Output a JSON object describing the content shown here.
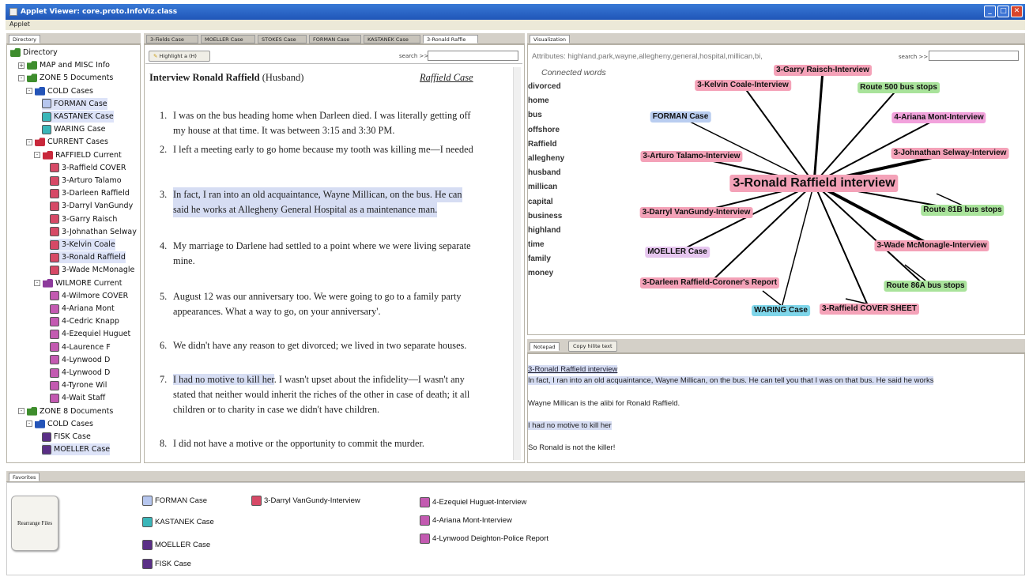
{
  "window": {
    "title": "Applet Viewer: core.proto.InfoViz.class",
    "menu": "Applet"
  },
  "directory": {
    "tab": "Directory",
    "rows": [
      {
        "label": "Directory",
        "icon": "folder-green",
        "indent": 0,
        "exp": ""
      },
      {
        "label": "MAP and MISC Info",
        "icon": "folder-green",
        "indent": 1,
        "exp": "+"
      },
      {
        "label": "ZONE 5 Documents",
        "icon": "folder-green",
        "indent": 1,
        "exp": "-"
      },
      {
        "label": "COLD Cases",
        "icon": "folder-blue",
        "indent": 2,
        "exp": "-"
      },
      {
        "label": "FORMAN Case",
        "icon": "doc-blue",
        "indent": 4,
        "exp": "",
        "selected": true
      },
      {
        "label": "KASTANEK Case",
        "icon": "doc-teal",
        "indent": 4,
        "exp": "",
        "selected": true
      },
      {
        "label": "WARING Case",
        "icon": "doc-teal",
        "indent": 4,
        "exp": ""
      },
      {
        "label": "CURRENT Cases",
        "icon": "folder-red",
        "indent": 2,
        "exp": "-"
      },
      {
        "label": "RAFFIELD Current",
        "icon": "folder-red",
        "indent": 3,
        "exp": "-"
      },
      {
        "label": "3-Raffield COVER",
        "icon": "doc-red",
        "indent": 5,
        "exp": ""
      },
      {
        "label": "3-Arturo Talamo",
        "icon": "doc-red",
        "indent": 5,
        "exp": ""
      },
      {
        "label": "3-Darleen Raffield",
        "icon": "doc-red",
        "indent": 5,
        "exp": ""
      },
      {
        "label": "3-Darryl VanGundy",
        "icon": "doc-red",
        "indent": 5,
        "exp": ""
      },
      {
        "label": "3-Garry Raisch",
        "icon": "doc-red",
        "indent": 5,
        "exp": ""
      },
      {
        "label": "3-Johnathan Selway",
        "icon": "doc-red",
        "indent": 5,
        "exp": ""
      },
      {
        "label": "3-Kelvin Coale",
        "icon": "doc-red",
        "indent": 5,
        "exp": "",
        "selected": true
      },
      {
        "label": "3-Ronald Raffield",
        "icon": "doc-red",
        "indent": 5,
        "exp": "",
        "selected": true
      },
      {
        "label": "3-Wade McMonagle",
        "icon": "doc-red",
        "indent": 5,
        "exp": ""
      },
      {
        "label": "WILMORE Current",
        "icon": "folder-purple",
        "indent": 3,
        "exp": "-"
      },
      {
        "label": "4-Wilmore COVER",
        "icon": "doc-purple",
        "indent": 5,
        "exp": ""
      },
      {
        "label": "4-Ariana Mont",
        "icon": "doc-purple",
        "indent": 5,
        "exp": ""
      },
      {
        "label": "4-Cedric Knapp",
        "icon": "doc-purple",
        "indent": 5,
        "exp": ""
      },
      {
        "label": "4-Ezequiel Huguet",
        "icon": "doc-purple",
        "indent": 5,
        "exp": ""
      },
      {
        "label": "4-Laurence F",
        "icon": "doc-purple",
        "indent": 5,
        "exp": ""
      },
      {
        "label": "4-Lynwood D",
        "icon": "doc-purple",
        "indent": 5,
        "exp": ""
      },
      {
        "label": "4-Lynwood D",
        "icon": "doc-purple",
        "indent": 5,
        "exp": ""
      },
      {
        "label": "4-Tyrone Wil",
        "icon": "doc-purple",
        "indent": 5,
        "exp": ""
      },
      {
        "label": "4-Wait Staff",
        "icon": "doc-purple",
        "indent": 5,
        "exp": ""
      },
      {
        "label": "ZONE 8 Documents",
        "icon": "folder-green",
        "indent": 1,
        "exp": "-"
      },
      {
        "label": "COLD Cases",
        "icon": "folder-blue",
        "indent": 2,
        "exp": "-"
      },
      {
        "label": "FISK Case",
        "icon": "doc-dpurple",
        "indent": 4,
        "exp": ""
      },
      {
        "label": "MOELLER Case",
        "icon": "doc-dpurple",
        "indent": 4,
        "exp": "",
        "selected": true
      }
    ]
  },
  "document": {
    "tabs": [
      "3-Fields Case",
      "MOELLER Case",
      "STOKES Case",
      "FORMAN Case",
      "KASTANEK Case",
      "3-Ronald Raffie"
    ],
    "active_tab": 5,
    "highlight_button": "Highlight a (H)",
    "search_label": "search >>",
    "title": "Interview Ronald Raffield",
    "title_suffix": "(Husband)",
    "case_link": "Raffield Case",
    "paragraphs": [
      {
        "num": "1.",
        "lines": [
          "I was on the bus heading home when Darleen died.  I was literally getting off",
          "my house at that time.  It was between 3:15 and 3:30 PM."
        ],
        "hl": []
      },
      {
        "num": "2.",
        "lines": [
          "I left a meeting early to go home because my tooth was killing me—I needed"
        ],
        "hl": []
      },
      {
        "num": "3.",
        "lines": [
          "In fact, I ran into an old acquaintance, Wayne Millican, on the bus.  He can",
          "said he works at Allegheny General Hospital as a maintenance man."
        ],
        "hl": [
          0,
          1
        ]
      },
      {
        "num": "4.",
        "lines": [
          "My marriage to Darlene had settled to a point where we were living separate",
          "mine."
        ],
        "hl": []
      },
      {
        "num": "5.",
        "lines": [
          "August 12 was our anniversary too.  We were going to go to a family party",
          "appearances.  What a way to go, on your anniversary'."
        ],
        "hl": []
      },
      {
        "num": "6.",
        "lines": [
          "We didn't have any reason to get divorced; we lived in two separate houses."
        ],
        "hl": []
      },
      {
        "num": "7.",
        "lines_hl_prefix": "I had no motive to kill her",
        "lines": [
          "I had no motive to kill her.  I wasn't upset about the infidelity—I wasn't any",
          "stated that neither would inherit the riches of the other in case of death; it all",
          "children or to charity in case we didn't have children."
        ],
        "hl": []
      },
      {
        "num": "8.",
        "lines": [
          "I did not have a motive or the opportunity to commit the murder."
        ],
        "hl": []
      }
    ]
  },
  "visualization": {
    "tab": "Visualization",
    "attributes": "Attributes: highland,park,wayne,allegheny,general,hospital,millican,bi,",
    "search_label": "search >>",
    "connected_words_label": "Connected words",
    "words": [
      "divorced",
      "home",
      "bus",
      "offshore",
      "Raffield",
      "allegheny",
      "husband",
      "millican",
      "capital",
      "business",
      "highland",
      "time",
      "family",
      "money"
    ],
    "center": "3-Ronald Raffield interview",
    "nodes": [
      {
        "label": "3-Garry Raisch-Interview",
        "color": "pink"
      },
      {
        "label": "3-Kelvin Coale-Interview",
        "color": "pink"
      },
      {
        "label": "Route 500 bus stops",
        "color": "green"
      },
      {
        "label": "FORMAN Case",
        "color": "blue"
      },
      {
        "label": "4-Ariana Mont-Interview",
        "color": "mag"
      },
      {
        "label": "3-Arturo Talamo-Interview",
        "color": "pink"
      },
      {
        "label": "3-Johnathan Selway-Interview",
        "color": "pink"
      },
      {
        "label": "3-Darryl VanGundy-Interview",
        "color": "pink"
      },
      {
        "label": "Route 81B bus stops",
        "color": "green"
      },
      {
        "label": "MOELLER Case",
        "color": "lav"
      },
      {
        "label": "3-Wade McMonagle-Interview",
        "color": "pink"
      },
      {
        "label": "3-Darleen Raffield-Coroner's Report",
        "color": "pink"
      },
      {
        "label": "Route 86A bus stops",
        "color": "green"
      },
      {
        "label": "WARING Case",
        "color": "cyan"
      },
      {
        "label": "3-Raffield COVER SHEET",
        "color": "pink"
      }
    ]
  },
  "notepad": {
    "tab": "Notepad",
    "copy_button": "Copy hilite text",
    "link": "3-Ronald Raffield interview",
    "line1": "In fact, I ran into an old acquaintance, Wayne Millican, on the bus.  He can tell you that I was on that bus.  He said he works",
    "line2": "Wayne Millican is the alibi for Ronald Raffield.",
    "line3": "I had no motive to kill her",
    "line4": "So Ronald is not the killer!"
  },
  "favorites": {
    "tab": "Favorites",
    "rearrange": "Rearrange Files",
    "items": [
      {
        "label": "FORMAN Case",
        "icon": "doc-blue"
      },
      {
        "label": "KASTANEK Case",
        "icon": "doc-teal"
      },
      {
        "label": "MOELLER Case",
        "icon": "doc-dpurple"
      },
      {
        "label": "FISK Case",
        "icon": "doc-dpurple"
      },
      {
        "label": "3-Darryl VanGundy-Interview",
        "icon": "doc-red"
      },
      {
        "label": "4-Ezequiel Huguet-Interview",
        "icon": "doc-purple"
      },
      {
        "label": "4-Ariana Mont-Interview",
        "icon": "doc-purple"
      },
      {
        "label": "4-Lynwood Deighton-Police Report",
        "icon": "doc-purple"
      }
    ]
  }
}
